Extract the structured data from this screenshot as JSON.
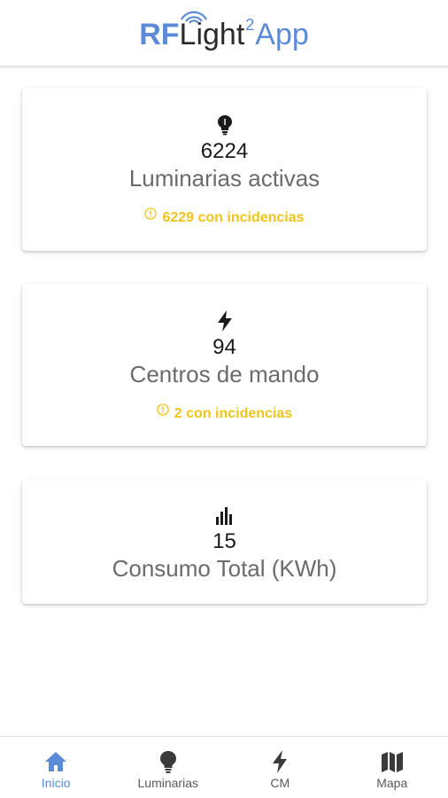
{
  "header": {
    "logo_rf": "RF",
    "logo_light": "Light",
    "logo_sup": "2",
    "logo_app": "App"
  },
  "cards": [
    {
      "icon": "lightbulb-icon",
      "value": "6224",
      "label": "Luminarias activas",
      "warning": "6229 con incidencias"
    },
    {
      "icon": "bolt-icon",
      "value": "94",
      "label": "Centros de mando",
      "warning": "2 con incidencias"
    },
    {
      "icon": "bar-chart-icon",
      "value": "15",
      "label": "Consumo Total (KWh)"
    }
  ],
  "nav": [
    {
      "label": "Inicio",
      "icon": "home-icon",
      "active": true
    },
    {
      "label": "Luminarias",
      "icon": "lightbulb-icon",
      "active": false
    },
    {
      "label": "CM",
      "icon": "bolt-icon",
      "active": false
    },
    {
      "label": "Mapa",
      "icon": "map-icon",
      "active": false
    }
  ],
  "colors": {
    "accent": "#5b8ad8",
    "warning": "#f0c419",
    "label_gray": "#6b6b6b"
  }
}
